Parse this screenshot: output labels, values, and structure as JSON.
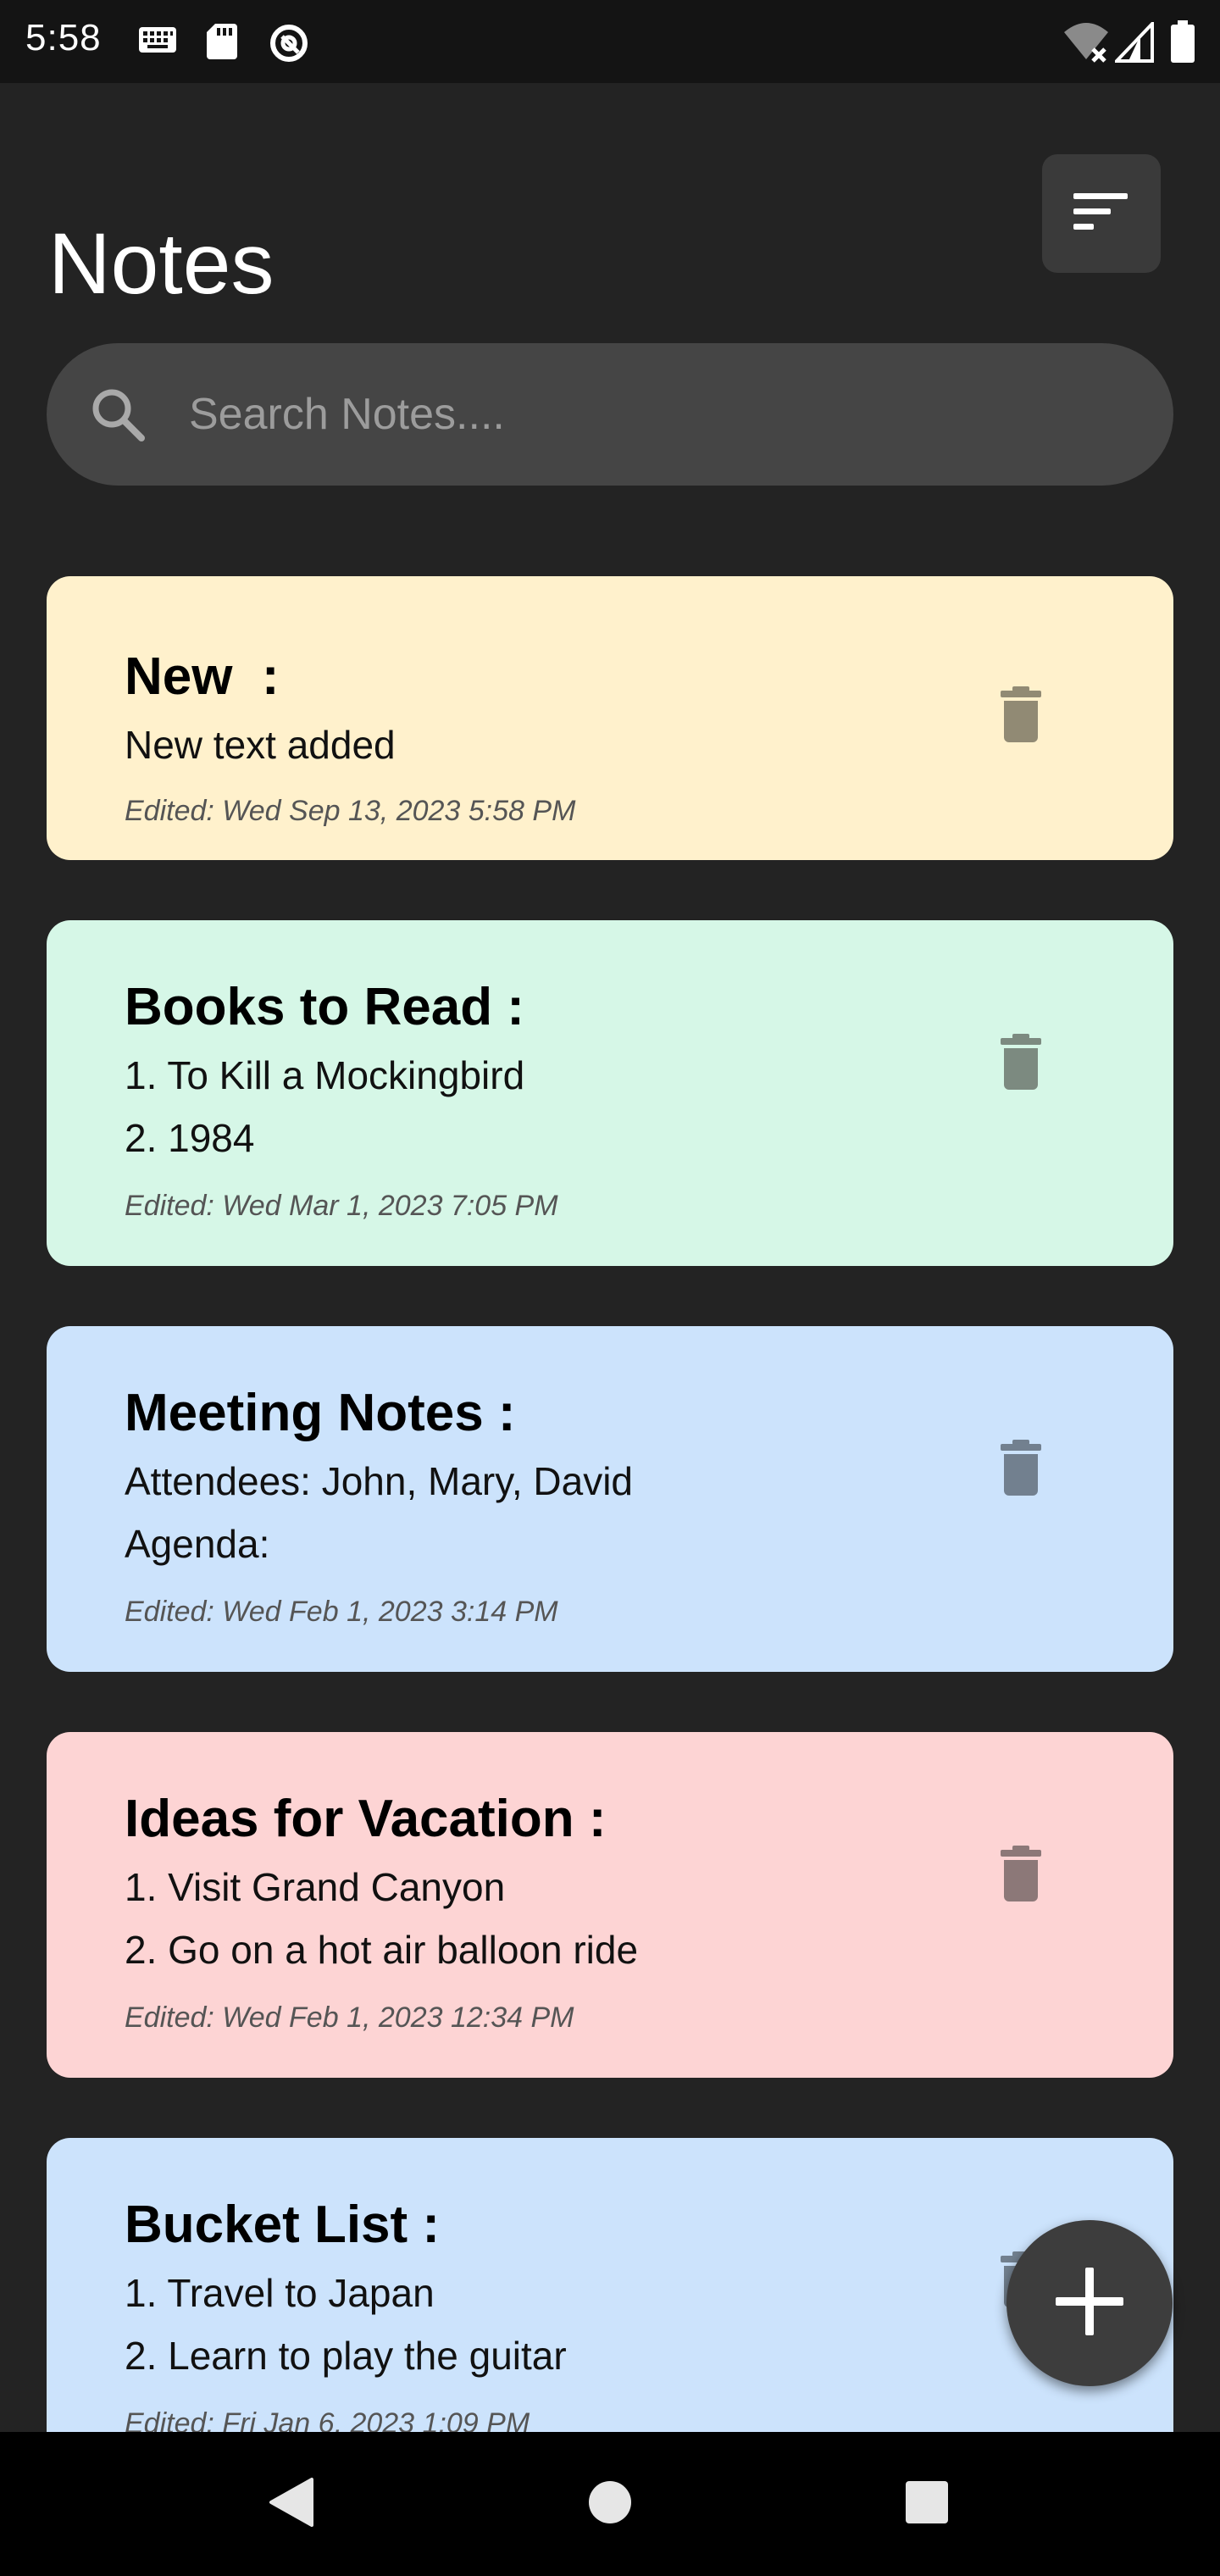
{
  "status_bar": {
    "time": "5:58",
    "left_icons": [
      "keyboard-icon",
      "sd-card-icon",
      "at-sign-icon"
    ],
    "right_icons": [
      "wifi-off-icon",
      "cellular-signal-icon",
      "battery-icon"
    ]
  },
  "header": {
    "title": "Notes",
    "sort_icon": "sort-icon"
  },
  "search": {
    "placeholder": "Search Notes....",
    "value": "",
    "icon": "search-icon"
  },
  "notes": [
    {
      "title": "New  :",
      "lines": [
        "New text added"
      ],
      "edited": "Edited: Wed Sep 13, 2023 5:58 PM",
      "color": "#fff1cc"
    },
    {
      "title": "Books to Read :",
      "lines": [
        "1. To Kill a Mockingbird",
        "2. 1984"
      ],
      "edited": "Edited: Wed Mar 1, 2023 7:05 PM",
      "color": "#d6f7e7"
    },
    {
      "title": "Meeting Notes :",
      "lines": [
        "Attendees: John, Mary, David",
        "Agenda:"
      ],
      "edited": "Edited: Wed Feb 1, 2023 3:14 PM",
      "color": "#cce3fc"
    },
    {
      "title": "Ideas for Vacation :",
      "lines": [
        "1. Visit Grand Canyon",
        "2. Go on a hot air balloon ride"
      ],
      "edited": "Edited: Wed Feb 1, 2023 12:34 PM",
      "color": "#fdd4d4"
    },
    {
      "title": "Bucket List :",
      "lines": [
        "1. Travel to Japan",
        "2. Learn to play the guitar"
      ],
      "edited": "Edited: Fri Jan 6, 2023 1:09 PM",
      "color": "#cce3fc"
    }
  ],
  "fab": {
    "icon": "plus-icon"
  },
  "nav_bar": {
    "icons": [
      "back-icon",
      "home-icon",
      "recents-icon"
    ]
  }
}
